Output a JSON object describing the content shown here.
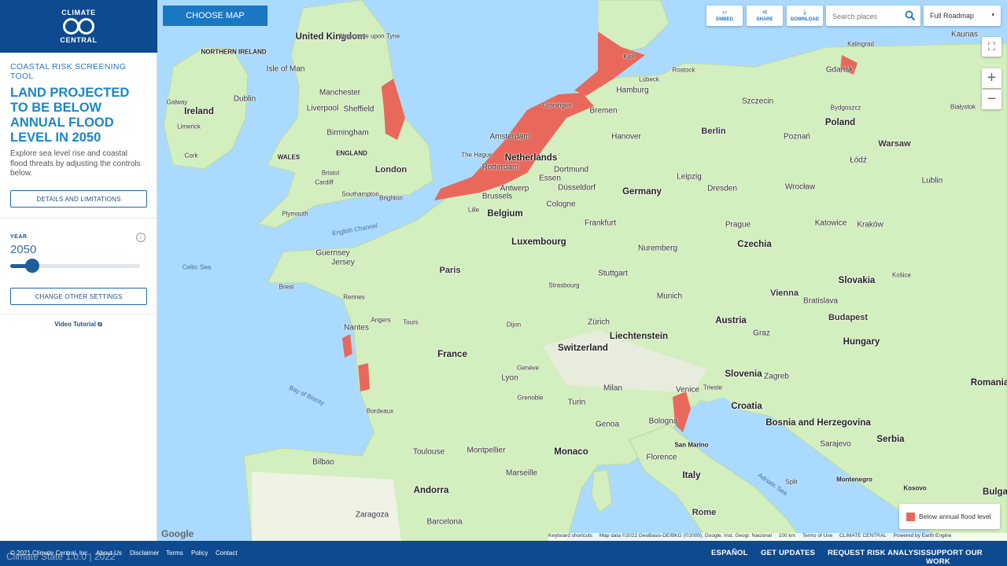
{
  "sidebar": {
    "logo": {
      "line1": "CLIMATE",
      "line2": "CENTRAL"
    },
    "tool_name": "COASTAL RISK SCREENING TOOL",
    "headline": "LAND PROJECTED TO BE BELOW ANNUAL FLOOD LEVEL IN 2050",
    "intro": "Explore sea level rise and coastal flood threats by adjusting the controls below.",
    "details_button": "DETAILS AND LIMITATIONS",
    "year_label": "YEAR",
    "year_value": "2050",
    "year_slider_fraction": 0.17,
    "settings_button": "CHANGE OTHER SETTINGS",
    "video_link": "Video Tutorial"
  },
  "map": {
    "choose_map": "CHOOSE MAP",
    "embed": "EMBED",
    "share": "SHARE",
    "download": "DOWNLOAD",
    "search_placeholder": "Search places",
    "layer_value": "Full Roadmap",
    "legend_label": "Below annual flood level",
    "colors": {
      "flood": "#e8695b",
      "land": "#d3eebf",
      "water": "#aadaff",
      "brand": "#0d4a8f"
    },
    "attribution": [
      "Keyboard shortcuts",
      "Map data ©2022 GeoBasis-DE/BKG (©2009), Google, Inst. Geogr. Nacional",
      "100 km",
      "Terms of Use",
      "CLIMATE CENTRAL",
      "Powered by Earth Engine"
    ],
    "google": "Google",
    "countries": [
      "United Kingdom",
      "NORTHERN IRELAND",
      "Ireland",
      "WALES",
      "ENGLAND",
      "Netherlands",
      "Belgium",
      "Luxembourg",
      "Germany",
      "Poland",
      "Czechia",
      "Slovakia",
      "Austria",
      "Hungary",
      "Liechtenstein",
      "Switzerland",
      "France",
      "Monaco",
      "Slovenia",
      "Croatia",
      "Bosnia and Herzegovina",
      "Serbia",
      "Romania",
      "Italy",
      "San Marino",
      "Andorra",
      "Montenegro",
      "Kosovo",
      "Bulga"
    ],
    "cities": [
      "Manchester",
      "Liverpool",
      "Sheffield",
      "Birmingham",
      "London",
      "Dublin",
      "Isle of Man",
      "Galway",
      "Limerick",
      "Cork",
      "Cardiff",
      "Bristol",
      "Brighton",
      "Southampton",
      "Plymouth",
      "Guernsey",
      "Jersey",
      "Paris",
      "Brest",
      "Rennes",
      "Nantes",
      "Tours",
      "Angers",
      "Dijon",
      "Lyon",
      "Bordeaux",
      "Toulouse",
      "Montpellier",
      "Marseille",
      "Genève",
      "Grenoble",
      "Bilbao",
      "Zaragoza",
      "Barcelona",
      "Amsterdam",
      "Rotterdam",
      "The Hague",
      "Antwerp",
      "Brussels",
      "Lille",
      "Essen",
      "Dortmund",
      "Düsseldorf",
      "Cologne",
      "Frankfurt",
      "Stuttgart",
      "Munich",
      "Nuremberg",
      "Hamburg",
      "Bremen",
      "Hanover",
      "Berlin",
      "Leipzig",
      "Dresden",
      "Prague",
      "Vienna",
      "Bratislava",
      "Budapest",
      "Zürich",
      "Milan",
      "Turin",
      "Genoa",
      "Bologna",
      "Florence",
      "Rome",
      "Venice",
      "Zagreb",
      "Graz",
      "Szczecin",
      "Gdańsk",
      "Poznań",
      "Łódź",
      "Warsaw",
      "Wrocław",
      "Katowice",
      "Kraków",
      "Lublin",
      "Kaunas",
      "Sarajevo",
      "Košice",
      "Rostock",
      "Lübeck",
      "Kiel",
      "Groningen",
      "Newcastle upon Tyne",
      "Strasbourg",
      "Trieste",
      "Split",
      "Kalingrad",
      "Bydgoszcz",
      "Białystok"
    ],
    "seas": [
      "Celtic Sea",
      "English Channel",
      "Bay of Biscay",
      "Adriatic Sea"
    ]
  },
  "footer": {
    "copyright": "© 2021 Climate Central, Inc.",
    "links": [
      "About Us",
      "Disclaimer",
      "Terms",
      "Policy",
      "Contact"
    ],
    "state": "Climate State 1.0.0 | 2022",
    "right_links": [
      "ESPAÑOL",
      "GET UPDATES",
      "REQUEST RISK ANALYSIS",
      "SUPPORT OUR WORK"
    ]
  }
}
